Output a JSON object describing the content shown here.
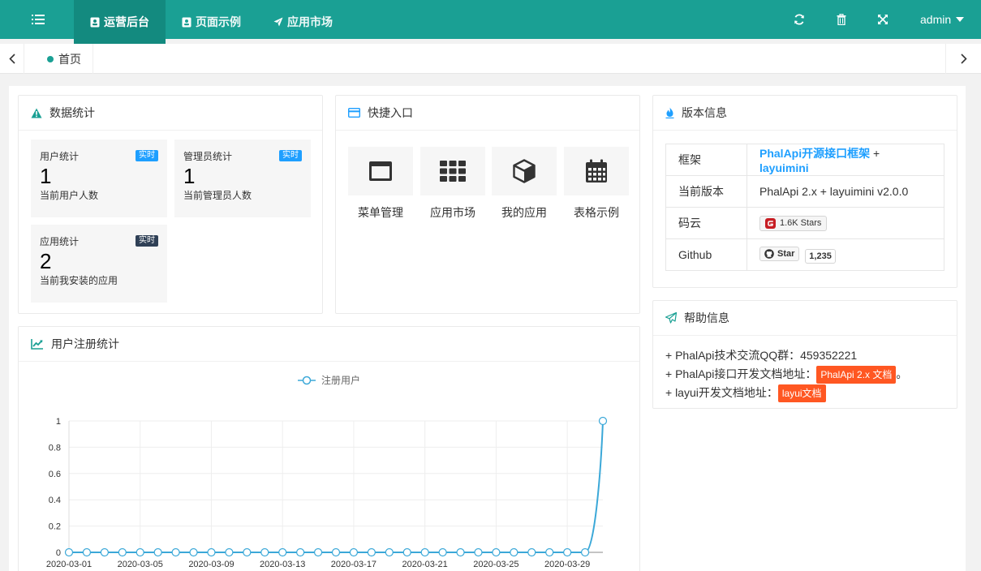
{
  "header": {
    "nav": [
      {
        "label": "运营后台",
        "icon": "contacts-icon",
        "active": true
      },
      {
        "label": "页面示例",
        "icon": "contacts-icon",
        "active": false
      },
      {
        "label": "应用市场",
        "icon": "rocket-icon",
        "active": false
      }
    ],
    "user": "admin",
    "brand_color": "#1aa094"
  },
  "tabs": {
    "home": "首页"
  },
  "stats_card": {
    "title": "数据统计",
    "items": [
      {
        "label": "用户统计",
        "badge": "实时",
        "value": "1",
        "desc": "当前用户人数",
        "badge_color": "#1e9fff"
      },
      {
        "label": "管理员统计",
        "badge": "实时",
        "value": "1",
        "desc": "当前管理员人数",
        "badge_color": "#1e9fff"
      },
      {
        "label": "应用统计",
        "badge": "实时",
        "value": "2",
        "desc": "当前我安装的应用",
        "badge_color": "#2f4056"
      }
    ]
  },
  "quick_card": {
    "title": "快捷入口",
    "items": [
      {
        "label": "菜单管理",
        "icon": "window-icon"
      },
      {
        "label": "应用市场",
        "icon": "grid-icon"
      },
      {
        "label": "我的应用",
        "icon": "cube-icon"
      },
      {
        "label": "表格示例",
        "icon": "calendar-icon"
      }
    ]
  },
  "version_card": {
    "title": "版本信息",
    "rows": [
      {
        "key": "框架",
        "link1": "PhalApi开源接口框架",
        "plus": "+",
        "link2": "layuimini"
      },
      {
        "key": "当前版本",
        "value": "PhalApi 2.x + layuimini v2.0.0"
      },
      {
        "key": "码云",
        "stars": "1.6K Stars"
      },
      {
        "key": "Github",
        "star_label": "Star",
        "star_count": "1,235"
      }
    ]
  },
  "help_card": {
    "title": "帮助信息",
    "line1": "+ PhalApi技术交流QQ群：459352221",
    "line2_prefix": "+ PhalApi接口开发文档地址：",
    "line2_badge": "PhalApi 2.x 文档",
    "line2_suffix": "。",
    "line3_prefix": "+ layui开发文档地址：",
    "line3_badge": "layui文档"
  },
  "chart_card": {
    "title": "用户注册统计"
  },
  "chart_data": {
    "type": "line",
    "legend": "注册用户",
    "legend_position": "top-center",
    "x": [
      "2020-03-01",
      "2020-03-02",
      "2020-03-03",
      "2020-03-04",
      "2020-03-05",
      "2020-03-06",
      "2020-03-07",
      "2020-03-08",
      "2020-03-09",
      "2020-03-10",
      "2020-03-11",
      "2020-03-12",
      "2020-03-13",
      "2020-03-14",
      "2020-03-15",
      "2020-03-16",
      "2020-03-17",
      "2020-03-18",
      "2020-03-19",
      "2020-03-20",
      "2020-03-21",
      "2020-03-22",
      "2020-03-23",
      "2020-03-24",
      "2020-03-25",
      "2020-03-26",
      "2020-03-27",
      "2020-03-28",
      "2020-03-29",
      "2020-03-30",
      "2020-03-31"
    ],
    "x_tick_labels": [
      "2020-03-01",
      "2020-03-05",
      "2020-03-09",
      "2020-03-13",
      "2020-03-17",
      "2020-03-21",
      "2020-03-25",
      "2020-03-29"
    ],
    "series": [
      {
        "name": "注册用户",
        "values": [
          0,
          0,
          0,
          0,
          0,
          0,
          0,
          0,
          0,
          0,
          0,
          0,
          0,
          0,
          0,
          0,
          0,
          0,
          0,
          0,
          0,
          0,
          0,
          0,
          0,
          0,
          0,
          0,
          0,
          0,
          1
        ]
      }
    ],
    "y_ticks": [
      "0",
      "0.2",
      "0.4",
      "0.6",
      "0.8",
      "1"
    ],
    "ylim": [
      0,
      1
    ],
    "grid": true,
    "line_color": "#3ba8d8"
  }
}
